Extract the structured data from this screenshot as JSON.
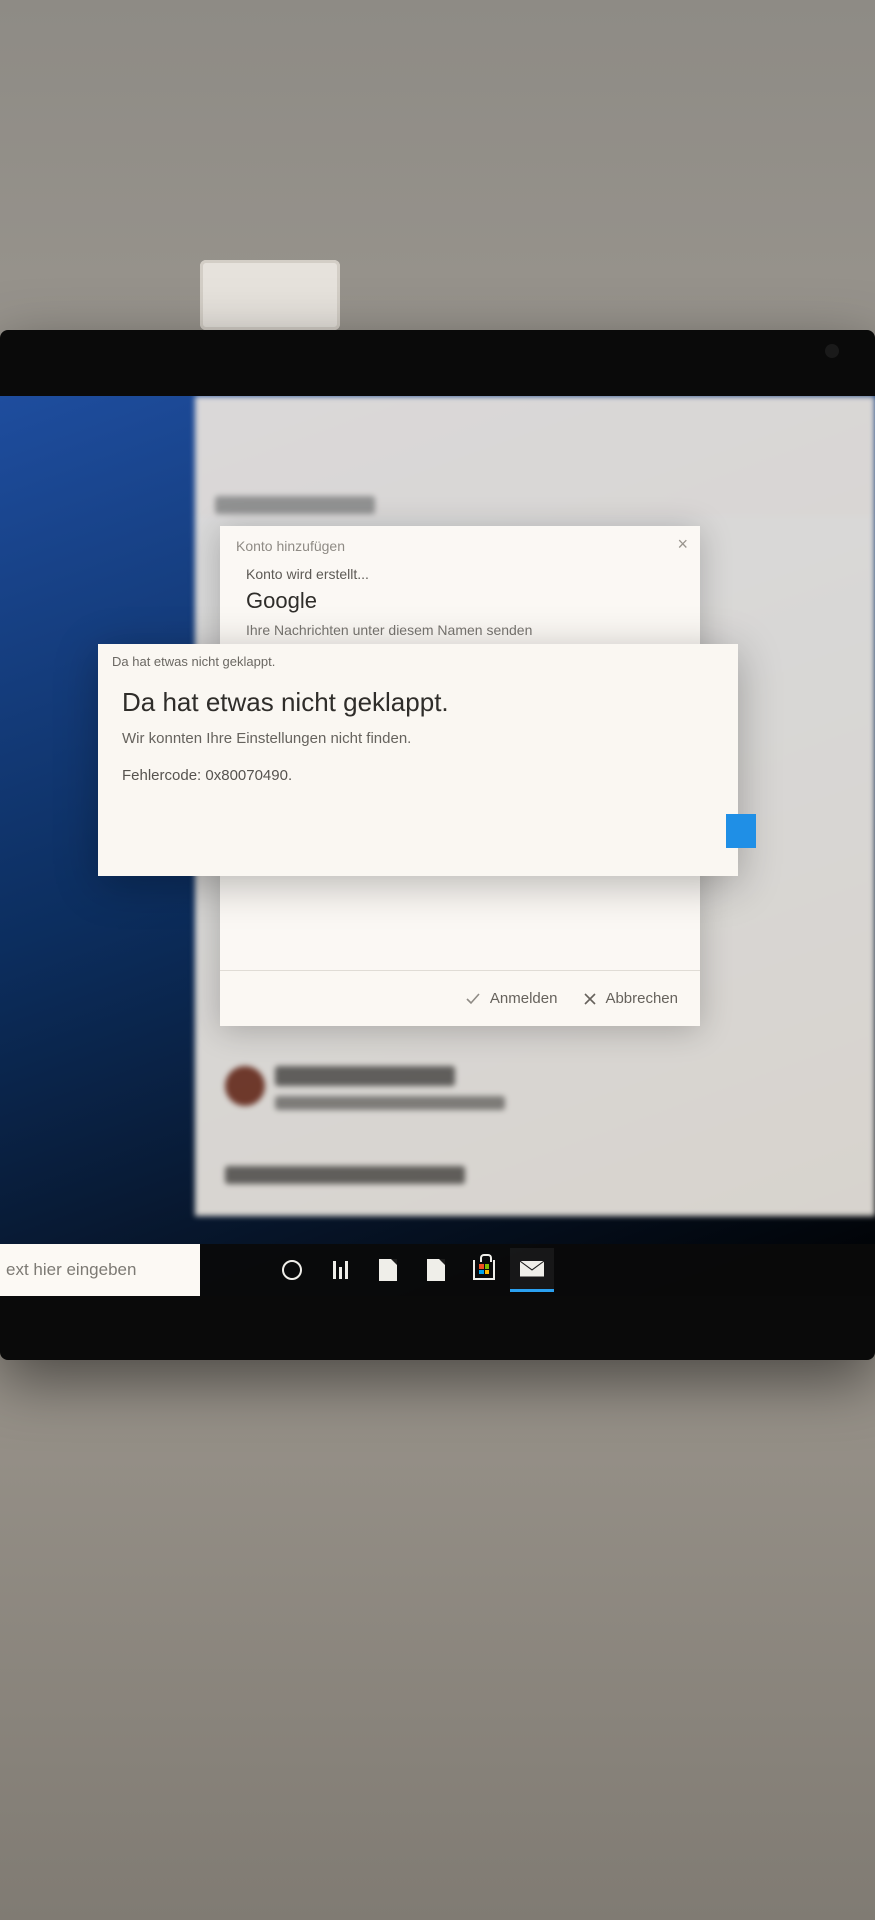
{
  "add_account_dialog": {
    "title": "Konto hinzufügen",
    "creating_label": "Konto wird erstellt...",
    "provider": "Google",
    "hint": "Ihre Nachrichten unter diesem Namen senden",
    "sign_in_label": "Anmelden",
    "cancel_label": "Abbrechen"
  },
  "error_dialog": {
    "titlebar": "Da hat etwas nicht geklappt.",
    "heading": "Da hat etwas nicht geklappt.",
    "message": "Wir konnten Ihre Einstellungen nicht finden.",
    "error_code_label": "Fehlercode: 0x80070490."
  },
  "taskbar": {
    "search_text": "ext hier eingeben"
  }
}
